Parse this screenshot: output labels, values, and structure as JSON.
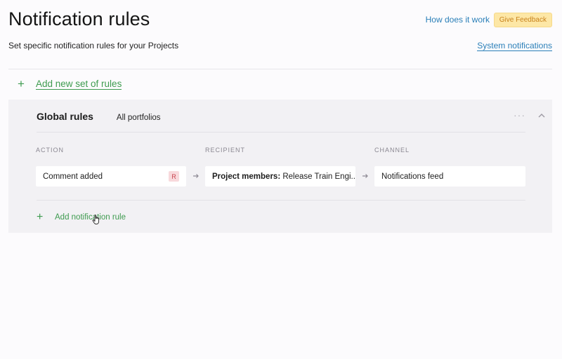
{
  "header": {
    "title": "Notification rules",
    "subtitle": "Set specific notification rules for your Projects",
    "how_link": "How does it work",
    "feedback_label": "Give Feedback",
    "system_link": "System notifications"
  },
  "add_set": {
    "label": "Add new set of rules",
    "icon": "plus-icon"
  },
  "rule_set": {
    "title": "Global rules",
    "scope": "All portfolios",
    "more_icon": "more-horizontal-icon",
    "collapse_icon": "chevron-up-icon",
    "columns": {
      "action": "ACTION",
      "recipient": "RECIPIENT",
      "channel": "CHANNEL"
    },
    "rules": [
      {
        "action": "Comment added",
        "action_badge": "R",
        "recipient_prefix": "Project members:",
        "recipient_value": " Release Train Engi...",
        "channel": "Notifications feed"
      }
    ],
    "add_rule_label": "Add notification rule"
  },
  "colors": {
    "accent_green": "#3e9b4f",
    "link_blue": "#2a7fb8",
    "feedback_bg": "#fde7a6",
    "badge_bg": "#f8d9dc",
    "panel_bg": "#f2f1f4"
  }
}
